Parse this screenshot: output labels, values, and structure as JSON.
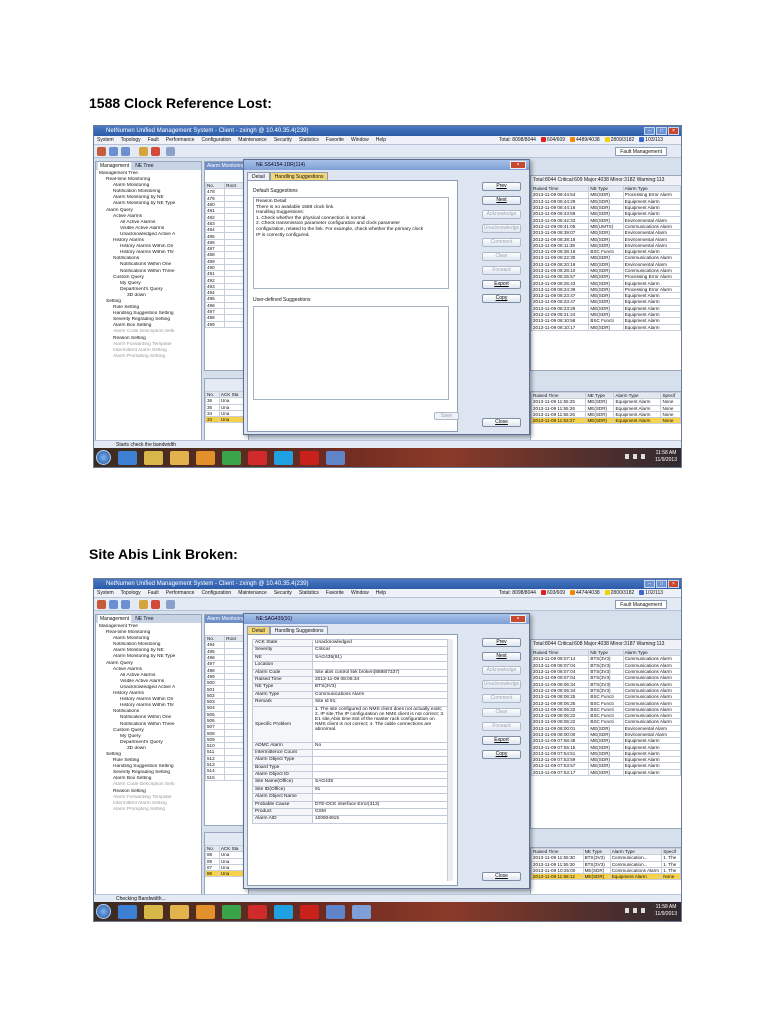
{
  "sections": [
    {
      "heading": "1588 Clock Reference Lost:",
      "window_title": "NetNumen Unified Management System - Client - zxingh @ 10.40.35.4(239)",
      "menus": [
        "System",
        "Topology",
        "Fault",
        "Performance",
        "Configuration",
        "Maintenance",
        "Security",
        "Statistics",
        "Favorite",
        "Window",
        "Help"
      ],
      "status": {
        "total": "Total: 8098/8044",
        "critical": "604/609",
        "major": "4489/4038",
        "minor": "2809/3182",
        "warning": "103/113"
      },
      "toolbar_dropdown": "Fault Management",
      "left_tabs": [
        "Management",
        "NE Tree"
      ],
      "tree": [
        "Management Tree",
        "Real-time Monitoring",
        "Alarm Monitoring",
        "Notification Monitoring",
        "Alarm Monitoring by NE",
        "Alarm Monitoring by NE Type",
        "Alarm Query",
        "Active Alarms",
        "All Active Alarms",
        "Visible Active Alarms",
        "Unacknowledged Active A",
        "History Alarms",
        "History Alarms Within On",
        "History Alarms Within Thr",
        "Notifications",
        "Notifications Within One",
        "Notifications Within Three",
        "Custom Query",
        "My Query",
        "Department's Query",
        "3D down",
        "Setting",
        "Rule Setting",
        "Handling Suggestion Setting",
        "Severity Regrading Setting",
        "Alarm Box Setting",
        "Alarm Code Description Setti",
        "Reason Setting",
        "Alarm Forwarding Template",
        "Intermittent Alarm Setting",
        "Alarm Prompting Setting"
      ],
      "mid_header": "Alarm Monitoring",
      "mid_cols": [
        "No.",
        "Root"
      ],
      "mid_rows": [
        "478",
        "479",
        "480",
        "481",
        "482",
        "483",
        "484",
        "485",
        "486",
        "487",
        "488",
        "489",
        "490",
        "491",
        "492",
        "493",
        "494",
        "495",
        "496",
        "497",
        "498",
        "499"
      ],
      "mid2_cols": [
        "No.",
        "ACK Sta"
      ],
      "mid2_rows": [
        "36",
        "35",
        "34",
        "33"
      ],
      "mid2_val": "Una",
      "right_stat": "Total:8044 Critical:609 Major:4038 Minor:3182 Warning:113",
      "right_cols": [
        "Raised Time",
        "NE Type",
        "Alarm Type"
      ],
      "right_rows": [
        [
          "2013-11-09 08:44:54",
          "ME(SDR)",
          "Processing Error Alarm"
        ],
        [
          "2013-11-09 08:44:29",
          "ME(SDR)",
          "Equipment Alarm"
        ],
        [
          "2013-11-09 08:44:16",
          "ME(SDR)",
          "Equipment Alarm"
        ],
        [
          "2013-11-09 08:43:59",
          "ME(SDR)",
          "Equipment Alarm"
        ],
        [
          "2013-11-09 08:42:33",
          "ME(SDR)",
          "Environmental Alarm"
        ],
        [
          "2013-11-09 08:41:05",
          "ME(UMTS)",
          "Communications Alarm"
        ],
        [
          "2013-11-09 08:39:07",
          "ME(SDR)",
          "Environmental Alarm"
        ],
        [
          "2013-11-09 08:38:18",
          "ME(SDR)",
          "Environmental Alarm"
        ],
        [
          "2013-11-09 08:11:39",
          "ME(SDR)",
          "Environmental Alarm"
        ],
        [
          "2013-11-09 08:38:19",
          "BSC Functi",
          "Equipment Alarm"
        ],
        [
          "2013-11-09 08:22:30",
          "ME(SDR)",
          "Communications Alarm"
        ],
        [
          "2013-11-09 08:20:19",
          "ME(SDR)",
          "Environmental Alarm"
        ],
        [
          "2013-11-09 08:28:10",
          "ME(SDR)",
          "Communications Alarm"
        ],
        [
          "2013-11-09 08:25:57",
          "ME(SDR)",
          "Processing Error Alarm"
        ],
        [
          "2013-11-09 08:25:43",
          "ME(SDR)",
          "Equipment Alarm"
        ],
        [
          "2013-11-09 08:24:39",
          "ME(SDR)",
          "Processing Error Alarm"
        ],
        [
          "2013-11-09 08:23:47",
          "ME(SDR)",
          "Equipment Alarm"
        ],
        [
          "2013-11-09 08:23:47",
          "ME(SDR)",
          "Equipment Alarm"
        ],
        [
          "2013-11-09 08:23:29",
          "ME(SDR)",
          "Equipment Alarm"
        ],
        [
          "2013-11-09 08:21:24",
          "ME(SDR)",
          "Equipment Alarm"
        ],
        [
          "2013-11-09 08:10:58",
          "BSC Functi",
          "Equipment Alarm"
        ],
        [
          "2013-11-09 08:10:17",
          "ME(SDR)",
          "Equipment Alarm"
        ]
      ],
      "right2_cols": [
        "Raised Time",
        "NE Type",
        "Alarm Type",
        "Specif"
      ],
      "right2_rows": [
        [
          "2013-11-09 11:55:25",
          "ME(SDR)",
          "Equipment Alarm",
          "None"
        ],
        [
          "2013-11-09 11:55:26",
          "ME(SDR)",
          "Equipment Alarm",
          "None"
        ],
        [
          "2013-11-09 11:55:26",
          "ME(SDR)",
          "Equipment Alarm",
          "None"
        ],
        [
          "2013-11-09 11:53:27",
          "ME(SDR)",
          "Equipment Alarm",
          "None"
        ]
      ],
      "statusbar": "Starts check the bandwidth",
      "clock": {
        "time": "11:58 AM",
        "date": "11/9/2013"
      },
      "dialog": {
        "title": "NE SS4154-1DR(114)",
        "tabs": [
          "Detail",
          "Handling Suggestions"
        ],
        "default_label": "Default Suggestions",
        "default_lines": [
          "Reason Detail:",
          "There is no available 1588 clock link.",
          "Handling Suggestions:",
          "1. Check whether the physical connection is normal.",
          "2. Check transmission parameter configuration and clock parameter",
          "configuration, related to the link. For example, check whether the primary clock",
          "IP is correctly configured."
        ],
        "user_label": "User-defined Suggestions",
        "save": "Save",
        "buttons": [
          "Prev",
          "Next",
          "Acknowledge",
          "Unacknowledge",
          "Comment",
          "Clear",
          "Forward",
          "Export",
          "Copy"
        ],
        "disabled": [
          false,
          false,
          true,
          true,
          true,
          true,
          true,
          false,
          false
        ],
        "close": "Close"
      }
    },
    {
      "heading": "Site Abis Link Broken:",
      "window_title": "NetNumen Unified Management System - Client - zxingh @ 10.40.35.4(239)",
      "menus": [
        "System",
        "Topology",
        "Fault",
        "Performance",
        "Configuration",
        "Maintenance",
        "Security",
        "Statistics",
        "Favorite",
        "Window",
        "Help"
      ],
      "status": {
        "total": "Total: 8098/8044",
        "critical": "603/609",
        "major": "4474/4038",
        "minor": "2800/3182",
        "warning": "102/113"
      },
      "toolbar_dropdown": "Fault Management",
      "left_tabs": [
        "Management",
        "NE Tree"
      ],
      "tree": [
        "Management Tree",
        "Real-time Monitoring",
        "Alarm Monitoring",
        "Notification Monitoring",
        "Alarm Monitoring by NE",
        "Alarm Monitoring by NE Type",
        "Alarm Query",
        "Active Alarms",
        "All Active Alarms",
        "Visible Active Alarms",
        "Unacknowledged Active A",
        "History Alarms",
        "History Alarms Within On",
        "History Alarms Within Thr",
        "Notifications",
        "Notifications Within One",
        "Notifications Within Three",
        "Custom Query",
        "My Query",
        "Department's Query",
        "3D down",
        "Setting",
        "Rule Setting",
        "Handling Suggestion Setting",
        "Severity Regrading Setting",
        "Alarm Box Setting",
        "Alarm Code Description Setti",
        "Reason Setting",
        "Alarm Forwarding Template",
        "Intermittent Alarm Setting",
        "Alarm Prompting Setting"
      ],
      "mid_header": "Alarm Monitoring",
      "mid_cols": [
        "No.",
        "Root"
      ],
      "mid_rows": [
        "494",
        "495",
        "496",
        "497",
        "498",
        "499",
        "500",
        "501",
        "502",
        "503",
        "504",
        "505",
        "506",
        "507",
        "508",
        "509",
        "510",
        "511",
        "512",
        "513",
        "514",
        "515"
      ],
      "mid2_cols": [
        "No.",
        "ACK Sta"
      ],
      "mid2_rows": [
        "88",
        "89",
        "87",
        "86"
      ],
      "mid2_val": "Una",
      "right_stat": "Total:8044 Critical:608 Major:4038 Minor:3187 Warning:113",
      "right_cols": [
        "Raised Time",
        "NE Type",
        "Alarm Type"
      ],
      "right_rows": [
        [
          "2013-11-09 08:07:14",
          "BTS(3V3)",
          "Communications Alarm"
        ],
        [
          "2013-11-09 08:07:04",
          "BTS(3V3)",
          "Communications Alarm"
        ],
        [
          "2013-11-09 08:07:04",
          "BTS(3V3)",
          "Communications Alarm"
        ],
        [
          "2013-11-09 08:07:04",
          "BTS(3V3)",
          "Communications Alarm"
        ],
        [
          "2013-11-09 08:06:34",
          "BTS(3V3)",
          "Communications Alarm"
        ],
        [
          "2013-11-09 08:06:34",
          "BTS(3V3)",
          "Communications Alarm"
        ],
        [
          "2013-11-09 08:06:25",
          "BSC Functi",
          "Communications Alarm"
        ],
        [
          "2013-11-09 08:06:25",
          "BSC Functi",
          "Communications Alarm"
        ],
        [
          "2013-11-09 08:06:22",
          "BSC Functi",
          "Communications Alarm"
        ],
        [
          "2013-11-09 08:06:22",
          "BSC Functi",
          "Communications Alarm"
        ],
        [
          "2013-11-09 08:06:22",
          "BSC Functi",
          "Communications Alarm"
        ],
        [
          "2013-11-09 08:00:01",
          "ME(SDR)",
          "Environmental Alarm"
        ],
        [
          "2013-11-09 08:00:00",
          "ME(SDR)",
          "Environmental Alarm"
        ],
        [
          "2013-11-09 07:58:48",
          "ME(SDR)",
          "Equipment Alarm"
        ],
        [
          "2013-11-09 07:55:15",
          "ME(SDR)",
          "Equipment Alarm"
        ],
        [
          "2013-11-09 07:54:51",
          "ME(SDR)",
          "Equipment Alarm"
        ],
        [
          "2013-11-09 07:53:59",
          "ME(SDR)",
          "Equipment Alarm"
        ],
        [
          "2013-11-09 07:53:57",
          "ME(SDR)",
          "Equipment Alarm"
        ],
        [
          "2013-11-09 07:53:17",
          "ME(SDR)",
          "Equipment Alarm"
        ]
      ],
      "right2_cols": [
        "Raised Time",
        "NE Type",
        "Alarm Type",
        "Specif"
      ],
      "right2_rows": [
        [
          "2013-11-09 11:55:30",
          "BTS(3V3)",
          "Communication...",
          "1. The"
        ],
        [
          "2013-11-09 11:55:30",
          "BTS(3V3)",
          "Communication...",
          "1. The"
        ],
        [
          "2013-11-09 10:25:00",
          "ME(SDR)",
          "Communications Alarm",
          "1. The"
        ],
        [
          "2013-11-09 11:58:12",
          "ME(SDR)",
          "Equipment Alarm",
          "None"
        ]
      ],
      "statusbar": "Checking Bandwidth...",
      "clock": {
        "time": "11:58 AM",
        "date": "11/9/2013"
      },
      "dialog": {
        "title": "NE:SAG435(91)",
        "tabs": [
          "Detail",
          "Handling Suggestions"
        ],
        "rows": [
          [
            "ACK State",
            "Unacknowledged"
          ],
          [
            "Severity",
            "Critical"
          ],
          [
            "NE",
            "SAG435(91)"
          ],
          [
            "Location",
            ""
          ],
          [
            "Alarm Code",
            "Site abis control link broken(8888/7337)"
          ],
          [
            "Raised Time",
            "2013-11-09 08:06:34"
          ],
          [
            "NE Type",
            "BTS(3V3)"
          ],
          [
            "Alarm Type",
            "Communications Alarm"
          ],
          [
            "Remark",
            "Site Id 91;"
          ],
          [
            "Specific Problem",
            "1. The site configured on NMS client does not actually exist; 2. IP site,The IP configuration on NMS client is not correct; 3. E1 site,Abis time slot of the master rack configuration on NMS client is not correct; 4. The cable connections are abnormal."
          ],
          [
            "ADMC Alarm",
            "No"
          ],
          [
            "Intermittence Count",
            ""
          ],
          [
            "Alarm Object Type",
            ""
          ],
          [
            "Board Type",
            ""
          ],
          [
            "Alarm Object ID",
            ""
          ],
          [
            "Site Name(Office)",
            "SAG435"
          ],
          [
            "Site ID(Office)",
            "91"
          ],
          [
            "Alarm Object Name",
            ""
          ],
          [
            "Probable Cause",
            "DTE-DCE interface Error(313)"
          ],
          [
            "Product",
            "GSM"
          ],
          [
            "Alarm AID",
            "100604915"
          ]
        ],
        "buttons": [
          "Prev",
          "Next",
          "Acknowledge",
          "Unacknowledge",
          "Comment",
          "Clear",
          "Forward",
          "Export",
          "Copy"
        ],
        "disabled": [
          false,
          false,
          true,
          true,
          true,
          true,
          true,
          false,
          false
        ],
        "close": "Close"
      }
    }
  ],
  "colors": {
    "critical": "#e02020",
    "major": "#f08a00",
    "minor": "#f2d200",
    "warning": "#3a67d6",
    "selected_row": "#f7d24a"
  }
}
